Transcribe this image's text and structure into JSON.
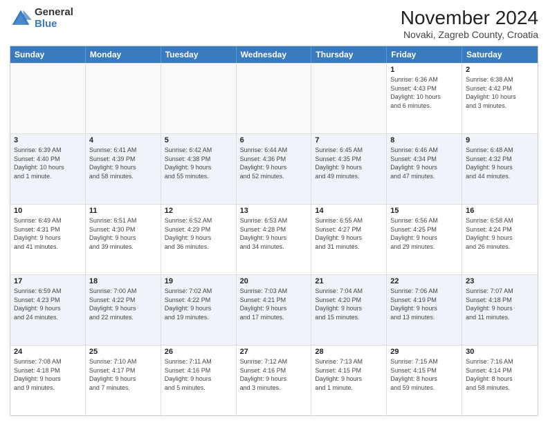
{
  "logo": {
    "general": "General",
    "blue": "Blue"
  },
  "header": {
    "month": "November 2024",
    "location": "Novaki, Zagreb County, Croatia"
  },
  "weekdays": [
    "Sunday",
    "Monday",
    "Tuesday",
    "Wednesday",
    "Thursday",
    "Friday",
    "Saturday"
  ],
  "rows": [
    [
      {
        "day": "",
        "info": "",
        "empty": true
      },
      {
        "day": "",
        "info": "",
        "empty": true
      },
      {
        "day": "",
        "info": "",
        "empty": true
      },
      {
        "day": "",
        "info": "",
        "empty": true
      },
      {
        "day": "",
        "info": "",
        "empty": true
      },
      {
        "day": "1",
        "info": "Sunrise: 6:36 AM\nSunset: 4:43 PM\nDaylight: 10 hours\nand 6 minutes.",
        "empty": false
      },
      {
        "day": "2",
        "info": "Sunrise: 6:38 AM\nSunset: 4:42 PM\nDaylight: 10 hours\nand 3 minutes.",
        "empty": false
      }
    ],
    [
      {
        "day": "3",
        "info": "Sunrise: 6:39 AM\nSunset: 4:40 PM\nDaylight: 10 hours\nand 1 minute.",
        "empty": false
      },
      {
        "day": "4",
        "info": "Sunrise: 6:41 AM\nSunset: 4:39 PM\nDaylight: 9 hours\nand 58 minutes.",
        "empty": false
      },
      {
        "day": "5",
        "info": "Sunrise: 6:42 AM\nSunset: 4:38 PM\nDaylight: 9 hours\nand 55 minutes.",
        "empty": false
      },
      {
        "day": "6",
        "info": "Sunrise: 6:44 AM\nSunset: 4:36 PM\nDaylight: 9 hours\nand 52 minutes.",
        "empty": false
      },
      {
        "day": "7",
        "info": "Sunrise: 6:45 AM\nSunset: 4:35 PM\nDaylight: 9 hours\nand 49 minutes.",
        "empty": false
      },
      {
        "day": "8",
        "info": "Sunrise: 6:46 AM\nSunset: 4:34 PM\nDaylight: 9 hours\nand 47 minutes.",
        "empty": false
      },
      {
        "day": "9",
        "info": "Sunrise: 6:48 AM\nSunset: 4:32 PM\nDaylight: 9 hours\nand 44 minutes.",
        "empty": false
      }
    ],
    [
      {
        "day": "10",
        "info": "Sunrise: 6:49 AM\nSunset: 4:31 PM\nDaylight: 9 hours\nand 41 minutes.",
        "empty": false
      },
      {
        "day": "11",
        "info": "Sunrise: 6:51 AM\nSunset: 4:30 PM\nDaylight: 9 hours\nand 39 minutes.",
        "empty": false
      },
      {
        "day": "12",
        "info": "Sunrise: 6:52 AM\nSunset: 4:29 PM\nDaylight: 9 hours\nand 36 minutes.",
        "empty": false
      },
      {
        "day": "13",
        "info": "Sunrise: 6:53 AM\nSunset: 4:28 PM\nDaylight: 9 hours\nand 34 minutes.",
        "empty": false
      },
      {
        "day": "14",
        "info": "Sunrise: 6:55 AM\nSunset: 4:27 PM\nDaylight: 9 hours\nand 31 minutes.",
        "empty": false
      },
      {
        "day": "15",
        "info": "Sunrise: 6:56 AM\nSunset: 4:25 PM\nDaylight: 9 hours\nand 29 minutes.",
        "empty": false
      },
      {
        "day": "16",
        "info": "Sunrise: 6:58 AM\nSunset: 4:24 PM\nDaylight: 9 hours\nand 26 minutes.",
        "empty": false
      }
    ],
    [
      {
        "day": "17",
        "info": "Sunrise: 6:59 AM\nSunset: 4:23 PM\nDaylight: 9 hours\nand 24 minutes.",
        "empty": false
      },
      {
        "day": "18",
        "info": "Sunrise: 7:00 AM\nSunset: 4:22 PM\nDaylight: 9 hours\nand 22 minutes.",
        "empty": false
      },
      {
        "day": "19",
        "info": "Sunrise: 7:02 AM\nSunset: 4:22 PM\nDaylight: 9 hours\nand 19 minutes.",
        "empty": false
      },
      {
        "day": "20",
        "info": "Sunrise: 7:03 AM\nSunset: 4:21 PM\nDaylight: 9 hours\nand 17 minutes.",
        "empty": false
      },
      {
        "day": "21",
        "info": "Sunrise: 7:04 AM\nSunset: 4:20 PM\nDaylight: 9 hours\nand 15 minutes.",
        "empty": false
      },
      {
        "day": "22",
        "info": "Sunrise: 7:06 AM\nSunset: 4:19 PM\nDaylight: 9 hours\nand 13 minutes.",
        "empty": false
      },
      {
        "day": "23",
        "info": "Sunrise: 7:07 AM\nSunset: 4:18 PM\nDaylight: 9 hours\nand 11 minutes.",
        "empty": false
      }
    ],
    [
      {
        "day": "24",
        "info": "Sunrise: 7:08 AM\nSunset: 4:18 PM\nDaylight: 9 hours\nand 9 minutes.",
        "empty": false
      },
      {
        "day": "25",
        "info": "Sunrise: 7:10 AM\nSunset: 4:17 PM\nDaylight: 9 hours\nand 7 minutes.",
        "empty": false
      },
      {
        "day": "26",
        "info": "Sunrise: 7:11 AM\nSunset: 4:16 PM\nDaylight: 9 hours\nand 5 minutes.",
        "empty": false
      },
      {
        "day": "27",
        "info": "Sunrise: 7:12 AM\nSunset: 4:16 PM\nDaylight: 9 hours\nand 3 minutes.",
        "empty": false
      },
      {
        "day": "28",
        "info": "Sunrise: 7:13 AM\nSunset: 4:15 PM\nDaylight: 9 hours\nand 1 minute.",
        "empty": false
      },
      {
        "day": "29",
        "info": "Sunrise: 7:15 AM\nSunset: 4:15 PM\nDaylight: 8 hours\nand 59 minutes.",
        "empty": false
      },
      {
        "day": "30",
        "info": "Sunrise: 7:16 AM\nSunset: 4:14 PM\nDaylight: 8 hours\nand 58 minutes.",
        "empty": false
      }
    ]
  ]
}
